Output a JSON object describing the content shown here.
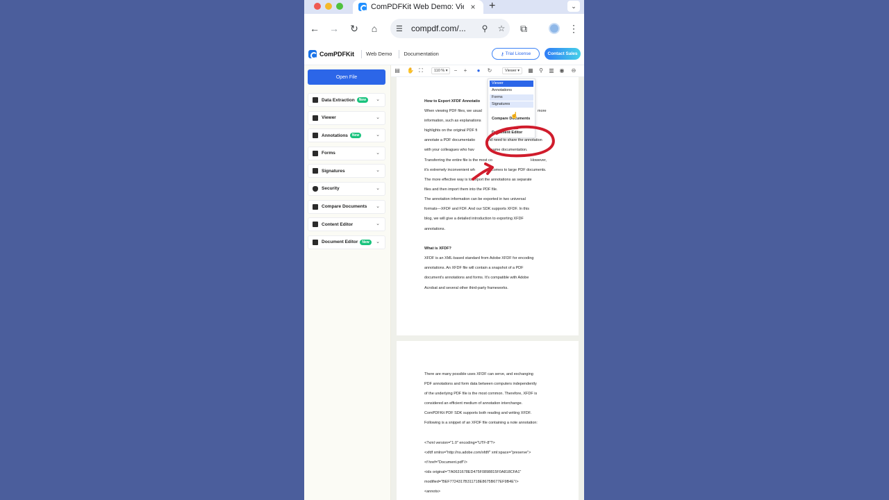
{
  "browser": {
    "tab_title": "ComPDFKit Web Demo: Viewer",
    "tab_close": "×",
    "new_tab": "+",
    "tab_menu": "⌄",
    "url": "compdf.com/...",
    "nav": {
      "back": "←",
      "forward": "→",
      "reload": "↻",
      "home": "⌂"
    },
    "icons": {
      "tune": "☰",
      "zoom": "⚲",
      "star": "☆",
      "extensions": "⧉",
      "menu": "⋮"
    }
  },
  "site": {
    "brand": "ComPDFKit",
    "links": [
      "Web Demo",
      "Documentation"
    ],
    "trial_label": "Trial License",
    "contact_label": "Contact Sales"
  },
  "sidebar": {
    "open_file": "Open File",
    "new_badge": "New",
    "items": [
      {
        "label": "Data Extraction",
        "badge": "New"
      },
      {
        "label": "Viewer",
        "badge": ""
      },
      {
        "label": "Annotations",
        "badge": "New"
      },
      {
        "label": "Forms",
        "badge": ""
      },
      {
        "label": "Signatures",
        "badge": ""
      },
      {
        "label": "Security",
        "badge": ""
      },
      {
        "label": "Compare Documents",
        "badge": ""
      },
      {
        "label": "Content Editor",
        "badge": ""
      },
      {
        "label": "Document Editor",
        "badge": "New"
      }
    ]
  },
  "toolbar": {
    "zoom": "110 % ▾",
    "mode": "Viewer ▾",
    "minus": "−",
    "plus": "+"
  },
  "dropdown": {
    "items": [
      "Viewer",
      "Annotations",
      "Forms",
      "Signatures",
      "Compare Documents",
      "Document Editor"
    ]
  },
  "document": {
    "page1": {
      "title": "How to Export XFDF Annotatio",
      "lines": [
        "When viewing PDF files, we usual",
        "information, such as explanations",
        "highlights on the original PDF fi",
        "annotate a PDF documentatio",
        "with your colleagues who hav",
        "Transferring the entire file is the most co",
        "it's extremely inconvenient wh",
        "The more effective way is to export the annotations as separate",
        "files and then import them into the PDF file.",
        "The annotation information can be exported in two universal",
        "formats—XFDF and FDF. And our SDK supports XFDF. In this",
        "blog, we will give a detailed introduction to exporting XFDF",
        "annotations."
      ],
      "right_fragments": [
        "more",
        "and need to share the annotation",
        "same documentation.",
        "However,",
        "comes to large PDF documents."
      ],
      "heading2": "What is XFDF?",
      "lines2": [
        "XFDF is an XML-based standard from Adobe XFDF for encoding",
        "annotations. An XFDF file will contain a snapshot of a PDF",
        "document's annotations and forms. It's compatible with Adobe",
        "Acrobat and several other third-party frameworks."
      ]
    },
    "page2": {
      "lines": [
        "There are many possible uses XFDF can serve, and exchanging",
        "PDF annotations and form data between computers independently",
        "of the underlying PDF file is the most common. Therefore, XFDF is",
        "considered an efficient medium of annotation interchange.",
        "ComPDFKit PDF SDK supports both reading and writing XFDF.",
        "Following is a snippet of an XFDF file containing a note annotation:"
      ],
      "code": [
        "<?xml version=\"1.0\" encoding=\"UTF-8\"?>",
        "<xfdf xmlns=\"http://ns.adobe.com/xfdf/\" xml:space=\"preserve\">",
        "<f href=\"Document.pdf\"/>",
        "<ids original=\"7A0631678ED475F0898815F0A818CFA1\"",
        "modified=\"BEF7724317B311718E8675B677EF9B4E\"/>",
        "<annots>"
      ]
    }
  },
  "colors": {
    "background": "#4b5e9c",
    "accent": "#2c66e8",
    "new_badge": "#19c37d",
    "annotation": "#d01c2c"
  }
}
